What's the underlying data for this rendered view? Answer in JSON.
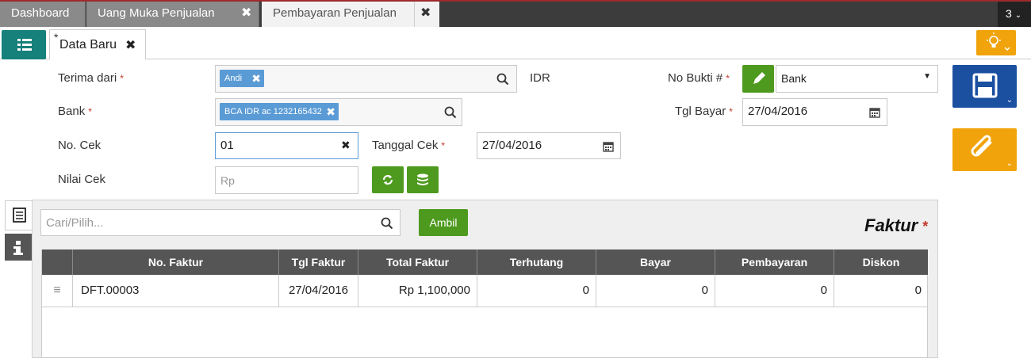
{
  "top_tabs": [
    {
      "label": "Dashboard"
    },
    {
      "label": "Uang Muka Penjualan"
    },
    {
      "label": "Pembayaran Penjualan"
    }
  ],
  "tab_count": "3",
  "doc_tab": {
    "modified_marker": "*",
    "label": "Data Baru"
  },
  "form": {
    "terima_dari": {
      "label": "Terima dari",
      "value": "Andi"
    },
    "currency": "IDR",
    "no_bukti": {
      "label": "No Bukti #",
      "value": "Bank"
    },
    "bank": {
      "label": "Bank",
      "value": "BCA IDR ac 1232165432"
    },
    "tgl_bayar": {
      "label": "Tgl Bayar",
      "value": "27/04/2016"
    },
    "no_cek": {
      "label": "No. Cek",
      "value": "01"
    },
    "tanggal_cek": {
      "label": "Tanggal Cek",
      "value": "27/04/2016"
    },
    "nilai_cek": {
      "label": "Nilai Cek",
      "placeholder": "Rp"
    },
    "required_marker": "*"
  },
  "panel": {
    "search_placeholder": "Cari/Pilih...",
    "ambil_label": "Ambil",
    "title": "Faktur"
  },
  "table": {
    "columns": [
      "No. Faktur",
      "Tgl Faktur",
      "Total Faktur",
      "Terhutang",
      "Bayar",
      "Pembayaran",
      "Diskon"
    ],
    "rows": [
      {
        "no_faktur": "DFT.00003",
        "tgl_faktur": "27/04/2016",
        "total_faktur": "Rp 1,100,000",
        "terhutang": "0",
        "bayar": "0",
        "pembayaran": "0",
        "diskon": "0"
      }
    ]
  },
  "colors": {
    "accent_teal": "#16807a",
    "save_blue": "#1b4fa0",
    "orange": "#f0a30a",
    "green": "#4e9a1e",
    "chip_blue": "#5b9bd5",
    "required_red": "#c0392b"
  }
}
